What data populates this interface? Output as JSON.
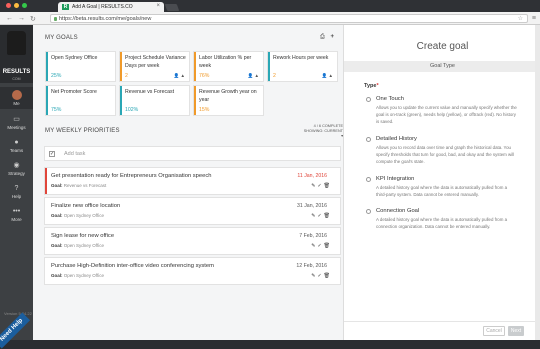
{
  "browser": {
    "tab_title": "Add A Goal | RESULTS.CO",
    "url": "https://beta.results.com/me/goals/new"
  },
  "sidebar": {
    "logo_text": "RESULTS",
    "logo_sub": "COM",
    "items": [
      {
        "label": "Me",
        "icon": "avatar"
      },
      {
        "label": "Meetings",
        "icon": "meetings-icon"
      },
      {
        "label": "Teams",
        "icon": "teams-icon"
      },
      {
        "label": "Strategy",
        "icon": "strategy-icon"
      },
      {
        "label": "Help",
        "icon": "help-icon"
      },
      {
        "label": "More",
        "icon": "more-icon"
      }
    ],
    "version": "Version 5.24.22",
    "need_help": "Need Help"
  },
  "goals": {
    "title": "MY GOALS",
    "cards": [
      {
        "title": "Open Sydney Office",
        "percent": "25%",
        "color": "#2aa7b5"
      },
      {
        "title": "Project Schedule Variance Days per week",
        "percent": "2",
        "color": "#f09a2a"
      },
      {
        "title": "Labor Utilization % per week",
        "percent": "76%",
        "color": "#f09a2a"
      },
      {
        "title": "Rework Hours per week",
        "percent": "2",
        "color": "#2aa7b5"
      },
      {
        "title": "Net Promoter Score",
        "percent": "75%",
        "color": "#2aa7b5"
      },
      {
        "title": "Revenue vs Forecast",
        "percent": "102%",
        "color": "#2aa7b5"
      },
      {
        "title": "Revenue Growth year on year",
        "percent": "15%",
        "color": "#f09a2a"
      }
    ]
  },
  "priorities": {
    "title": "MY WEEKLY PRIORITIES",
    "complete": "4 / 6 COMPLETE",
    "showing": "SHOWING: CURRENT ▾",
    "add_task_placeholder": "Add task",
    "goal_label": "Goal:",
    "tasks": [
      {
        "title": "Get presentation ready for Entrepreneurs Organisation speech",
        "date": "11 Jan, 2016",
        "goal": "Revenue vs Forecast",
        "overdue": true
      },
      {
        "title": "Finalize new office location",
        "date": "31 Jan, 2016",
        "goal": "Open Sydney Office",
        "overdue": false
      },
      {
        "title": "Sign lease for new office",
        "date": "7 Feb, 2016",
        "goal": "Open Sydney Office",
        "overdue": false
      },
      {
        "title": "Purchase High-Definition inter-office video conferencing system",
        "date": "12 Feb, 2016",
        "goal": "Open Sydney Office",
        "overdue": false
      }
    ]
  },
  "panel": {
    "title": "Create goal",
    "band": "Goal Type",
    "type_label": "Type",
    "options": [
      {
        "title": "One Touch",
        "desc": "Allows you to update the current value and manually specify whether the goal is on-track (green), needs help (yellow), or offtrack (red). No history is saved."
      },
      {
        "title": "Detailed History",
        "desc": "Allows you to record data over time and graph the historical data. You specify thresholds that turn for good, bad, and okay and the system will compute the goal's state."
      },
      {
        "title": "KPI Integration",
        "desc": "A detailed history goal where the data is automatically pulled from a third-party system. Data cannot be entered manually."
      },
      {
        "title": "Connection Goal",
        "desc": "A detailed history goal where the data is automatically pulled from a connection organization. Data cannot be entered manually."
      }
    ],
    "cancel": "Cancel",
    "next": "Next"
  }
}
